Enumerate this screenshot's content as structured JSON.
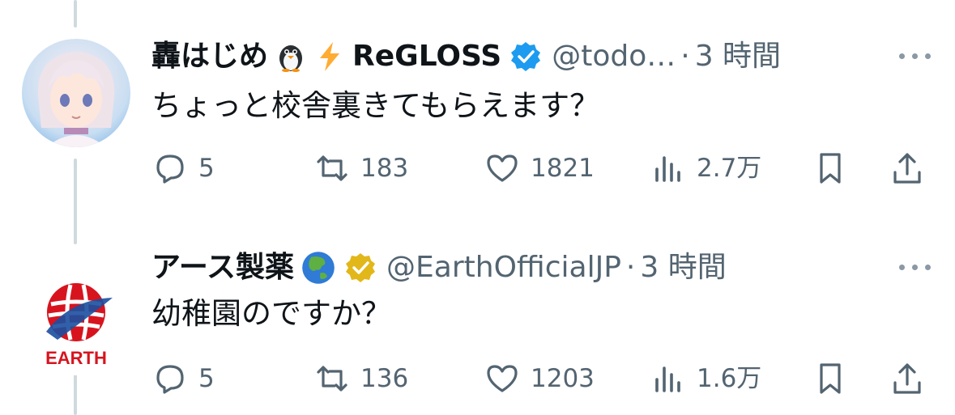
{
  "tweets": [
    {
      "display_name": "轟はじめ",
      "emoji_1": "penguin",
      "emoji_2": "high-voltage",
      "group": "ReGLOSS",
      "verified_badge": "blue-check",
      "handle": "@todo…",
      "separator": "·",
      "time": "3 時間",
      "text": "ちょっと校舎裏きてもらえます？",
      "replies": "5",
      "retweets": "183",
      "likes": "1821",
      "views": "2.7万"
    },
    {
      "display_name": "アース製薬",
      "emoji_1": "globe-asia",
      "verified_badge": "gold-check",
      "handle": "@EarthOfficialJP",
      "separator": "·",
      "time": "3 時間",
      "text": "幼稚園のですか？",
      "avatar_logo_text": "EARTH",
      "replies": "5",
      "retweets": "136",
      "likes": "1203",
      "views": "1.6万"
    }
  ],
  "colors": {
    "text": "#0f1419",
    "muted": "#536471",
    "thread_line": "#cfd9de",
    "verified_blue": "#1d9bf0",
    "verified_gold": "#e2b719",
    "earth_red": "#d7141e",
    "earth_blue": "#1b4fa0"
  }
}
